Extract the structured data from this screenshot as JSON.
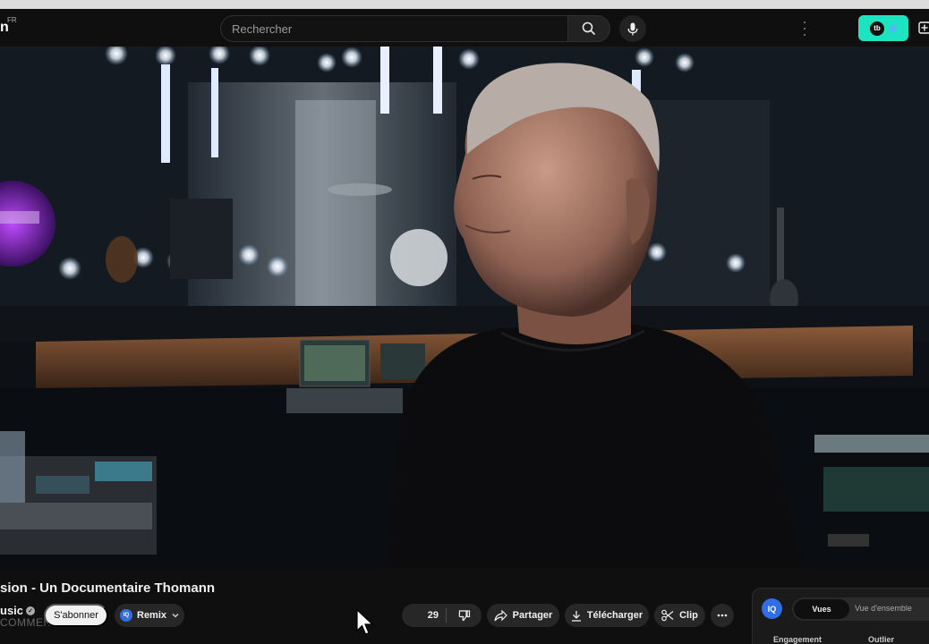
{
  "masthead": {
    "logo_fragment": "n",
    "logo_region": "FR",
    "search_placeholder": "Rechercher",
    "extension_logo_text": "tb"
  },
  "video": {
    "title": "sion - Un Documentaire Thomann"
  },
  "channel": {
    "name": "usic",
    "subscribe_label": "S'abonner",
    "comment_overlay": "COMMENTAI"
  },
  "actions": {
    "remix_badge": "IQ",
    "remix_label": "Remix",
    "like_count": "29",
    "share_label": "Partager",
    "download_label": "Télécharger",
    "clip_label": "Clip"
  },
  "side_panel": {
    "badge": "IQ",
    "tab_active": "Vues",
    "tab_inactive": "Vue d'ensemble",
    "label_left": "Engagement",
    "label_right": "Outlier"
  },
  "colors": {
    "background": "#0f0f0f",
    "pill": "#272727",
    "extension_accent": "#1ee3c0",
    "iq_blue": "#2f6ee6"
  },
  "icons": [
    "search-icon",
    "microphone-icon",
    "more-vertical-icon",
    "create-icon",
    "verified-icon",
    "chevron-down-icon",
    "dislike-icon",
    "share-icon",
    "download-icon",
    "scissors-icon",
    "more-horizontal-icon",
    "mouse-cursor-icon"
  ]
}
